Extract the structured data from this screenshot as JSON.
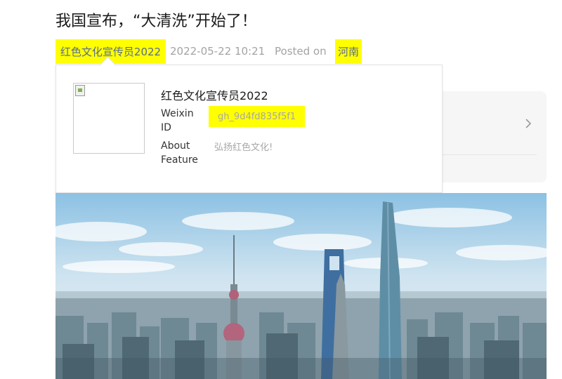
{
  "article": {
    "title": "我国宣布，“大清洗”开始了！",
    "author": "红色文化宣传员2022",
    "datetime": "2022-05-22 10:21",
    "posted_on_label": "Posted on",
    "location": "河南"
  },
  "profile_popup": {
    "name": "红色文化宣传员2022",
    "weixin_id_label": "Weixin ID",
    "weixin_id": "gh_9d4fd835f5f1",
    "about_label": "About Feature",
    "about_value": "弘扬红色文化!"
  },
  "icons": {
    "avatar": "broken-image-icon",
    "card_arrow": "chevron-right-icon"
  },
  "colors": {
    "highlight": "#ffff00",
    "link": "#576b95",
    "meta_gray": "#a3a3a3"
  }
}
